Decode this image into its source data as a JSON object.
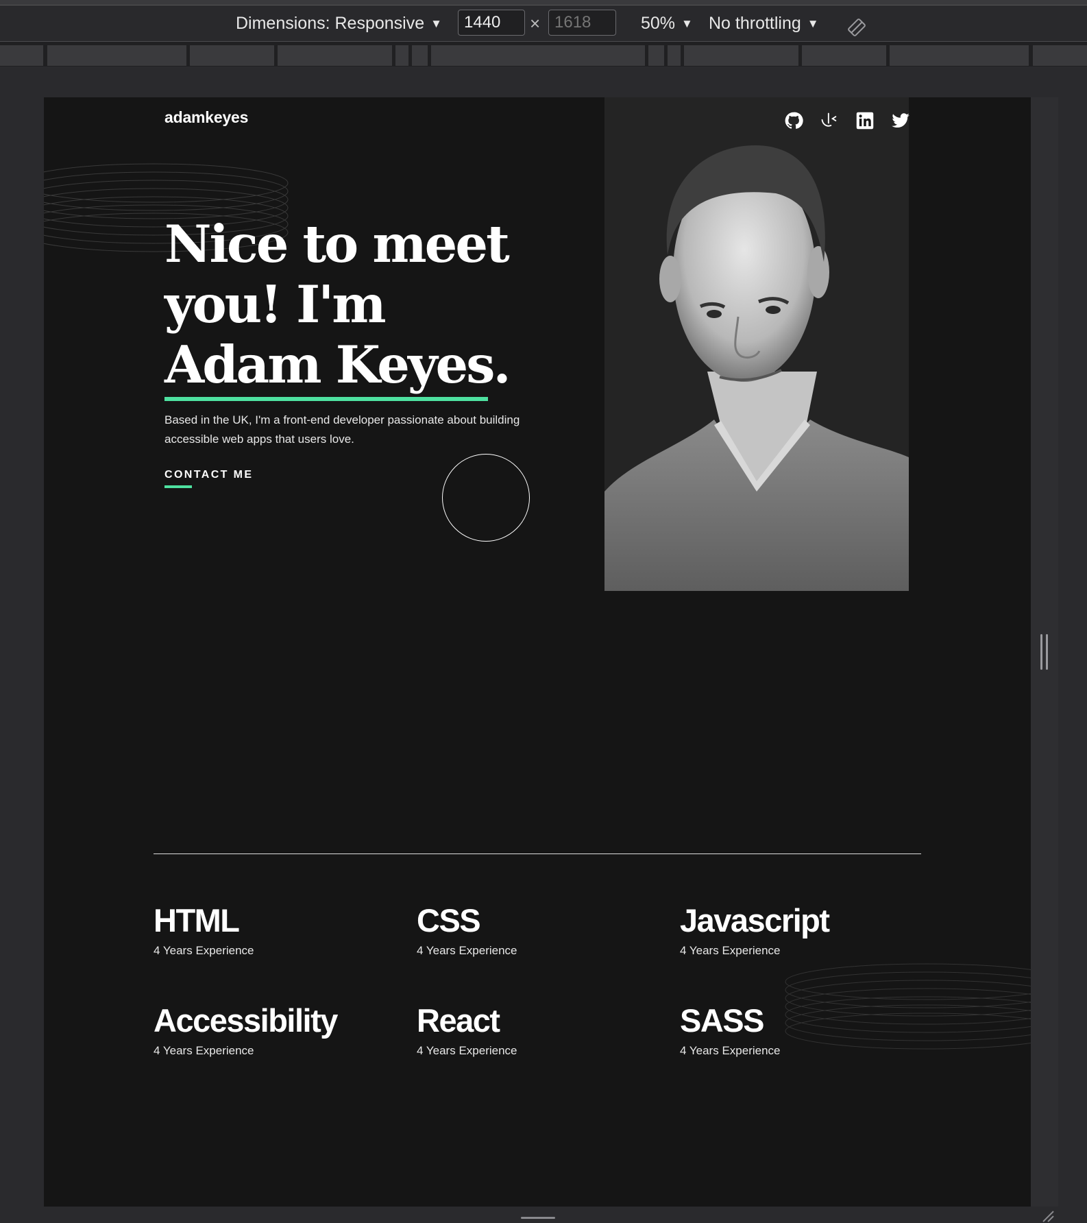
{
  "devtools": {
    "dimensions_label": "Dimensions: Responsive",
    "width_value": "1440",
    "height_placeholder": "1618",
    "times_symbol": "×",
    "zoom_label": "50%",
    "throttling_label": "No throttling",
    "caret": "▼"
  },
  "site": {
    "logo": "adamkeyes",
    "social_icons": [
      "github-icon",
      "frontend-mentor-icon",
      "linkedin-icon",
      "twitter-icon"
    ],
    "headline": [
      "Nice to meet",
      "you! I'm",
      "Adam Keyes."
    ],
    "intro": "Based in the UK, I'm a front-end developer passionate about building accessible web apps that users love.",
    "contact_label": "CONTACT ME",
    "accent_color": "#4ee1a0",
    "skills": [
      {
        "name": "HTML",
        "experience": "4 Years Experience"
      },
      {
        "name": "CSS",
        "experience": "4 Years Experience"
      },
      {
        "name": "Javascript",
        "experience": "4 Years Experience"
      },
      {
        "name": "Accessibility",
        "experience": "4 Years Experience"
      },
      {
        "name": "React",
        "experience": "4 Years Experience"
      },
      {
        "name": "SASS",
        "experience": "4 Years Experience"
      }
    ]
  }
}
